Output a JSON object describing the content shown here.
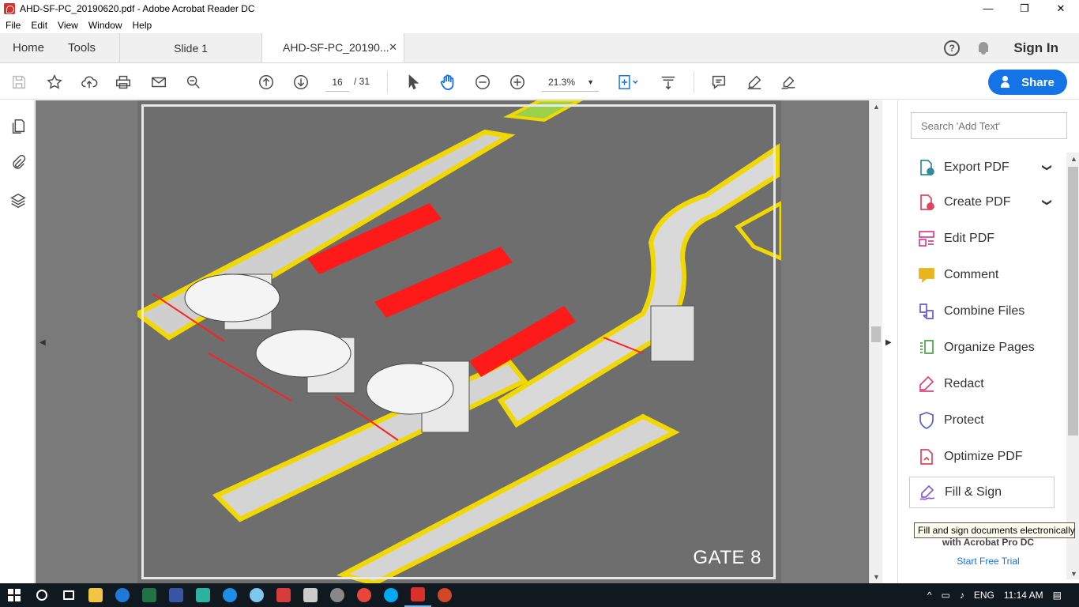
{
  "window": {
    "title": "AHD-SF-PC_20190620.pdf - Adobe Acrobat Reader DC",
    "minimize": "—",
    "maximize": "❐",
    "close": "✕"
  },
  "menu": [
    "File",
    "Edit",
    "View",
    "Window",
    "Help"
  ],
  "tabs": {
    "home": "Home",
    "tools": "Tools",
    "slide": "Slide 1",
    "doc": "AHD-SF-PC_20190...",
    "close": "✕"
  },
  "header": {
    "help": "?",
    "signin": "Sign In"
  },
  "toolbar": {
    "page_current": "16",
    "page_total": "/ 31",
    "zoom": "21.3%",
    "zoom_caret": "▼",
    "share": "Share"
  },
  "page": {
    "gate_label": "GATE 8"
  },
  "scroll": {
    "up": "▲",
    "down": "▼",
    "left": "◀",
    "right": "▶"
  },
  "rightpanel": {
    "search_placeholder": "Search 'Add Text'",
    "tools": [
      {
        "label": "Export PDF",
        "icon": "export-pdf-icon",
        "color": "#2d8c9e",
        "chevron": "❯"
      },
      {
        "label": "Create PDF",
        "icon": "create-pdf-icon",
        "color": "#e0435c",
        "chevron": "❯"
      },
      {
        "label": "Edit PDF",
        "icon": "edit-pdf-icon",
        "color": "#d8408e"
      },
      {
        "label": "Comment",
        "icon": "comment-icon",
        "color": "#e8b51a"
      },
      {
        "label": "Combine Files",
        "icon": "combine-files-icon",
        "color": "#6a5acd"
      },
      {
        "label": "Organize Pages",
        "icon": "organize-pages-icon",
        "color": "#48a346"
      },
      {
        "label": "Redact",
        "icon": "redact-icon",
        "color": "#e0437a"
      },
      {
        "label": "Protect",
        "icon": "protect-icon",
        "color": "#5b5fc7"
      },
      {
        "label": "Optimize PDF",
        "icon": "optimize-pdf-icon",
        "color": "#e0435c"
      },
      {
        "label": "Fill & Sign",
        "icon": "fill-sign-icon",
        "color": "#8a5cd8"
      }
    ],
    "tooltip": "Fill and sign documents electronically",
    "promo": "with Acrobat Pro DC",
    "trial": "Start Free Trial"
  },
  "taskbar": {
    "lang": "ENG",
    "time": "11:14 AM"
  }
}
